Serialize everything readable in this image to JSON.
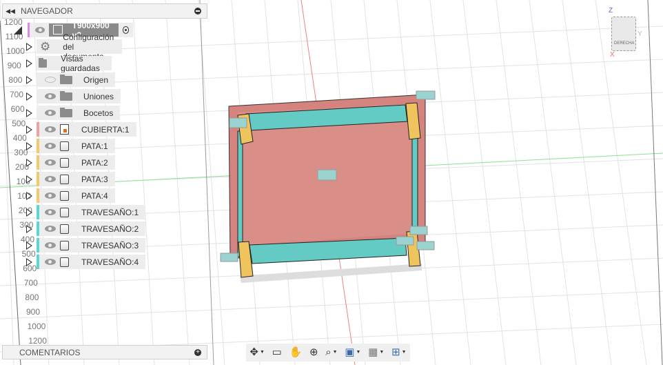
{
  "navigator": {
    "title": "NAVEGADOR",
    "root": {
      "name": "T900x900 v2",
      "accent": "#d98ce0"
    },
    "items": [
      {
        "label": "Configuración del documento",
        "icon": "gear-icon"
      },
      {
        "label": "Vistas guardadas",
        "icon": "folder-icon"
      },
      {
        "label": "Origen",
        "icon": "folder-icon",
        "visible": false
      },
      {
        "label": "Uniones",
        "icon": "folder-icon",
        "visible": true
      },
      {
        "label": "Bocetos",
        "icon": "folder-icon",
        "visible": true
      },
      {
        "label": "CUBIERTA:1",
        "icon": "component-icon",
        "color": "#f4a0a0"
      },
      {
        "label": "PATA:1",
        "icon": "body-icon",
        "color": "#f5c96a"
      },
      {
        "label": "PATA:2",
        "icon": "body-icon",
        "color": "#f5c96a"
      },
      {
        "label": "PATA:3",
        "icon": "body-icon",
        "color": "#f5c96a"
      },
      {
        "label": "PATA:4",
        "icon": "body-icon",
        "color": "#f5c96a"
      },
      {
        "label": "TRAVESAÑO:1",
        "icon": "body-icon",
        "color": "#5bd6d6"
      },
      {
        "label": "TRAVESAÑO:2",
        "icon": "body-icon",
        "color": "#5bd6d6"
      },
      {
        "label": "TRAVESAÑO:3",
        "icon": "body-icon",
        "color": "#5bd6d6"
      },
      {
        "label": "TRAVESAÑO:4",
        "icon": "body-icon",
        "color": "#5bd6d6"
      }
    ]
  },
  "ruler_labels": [
    "1200",
    "1100",
    "1000",
    "900",
    "800",
    "700",
    "600",
    "500",
    "400",
    "300",
    "200",
    "100",
    "100",
    "200",
    "300",
    "400",
    "500",
    "600",
    "700",
    "800",
    "900",
    "1000",
    "1200"
  ],
  "comments": {
    "title": "COMENTARIOS"
  },
  "viewcube": {
    "face": "DERECHA",
    "axes": [
      "Z",
      "Y",
      "X"
    ]
  },
  "toolbar": [
    "orbit-icon",
    "look-at-icon",
    "pan-icon",
    "zoom-icon",
    "fit-icon",
    "display-settings-icon",
    "grid-icon",
    "viewports-icon"
  ]
}
